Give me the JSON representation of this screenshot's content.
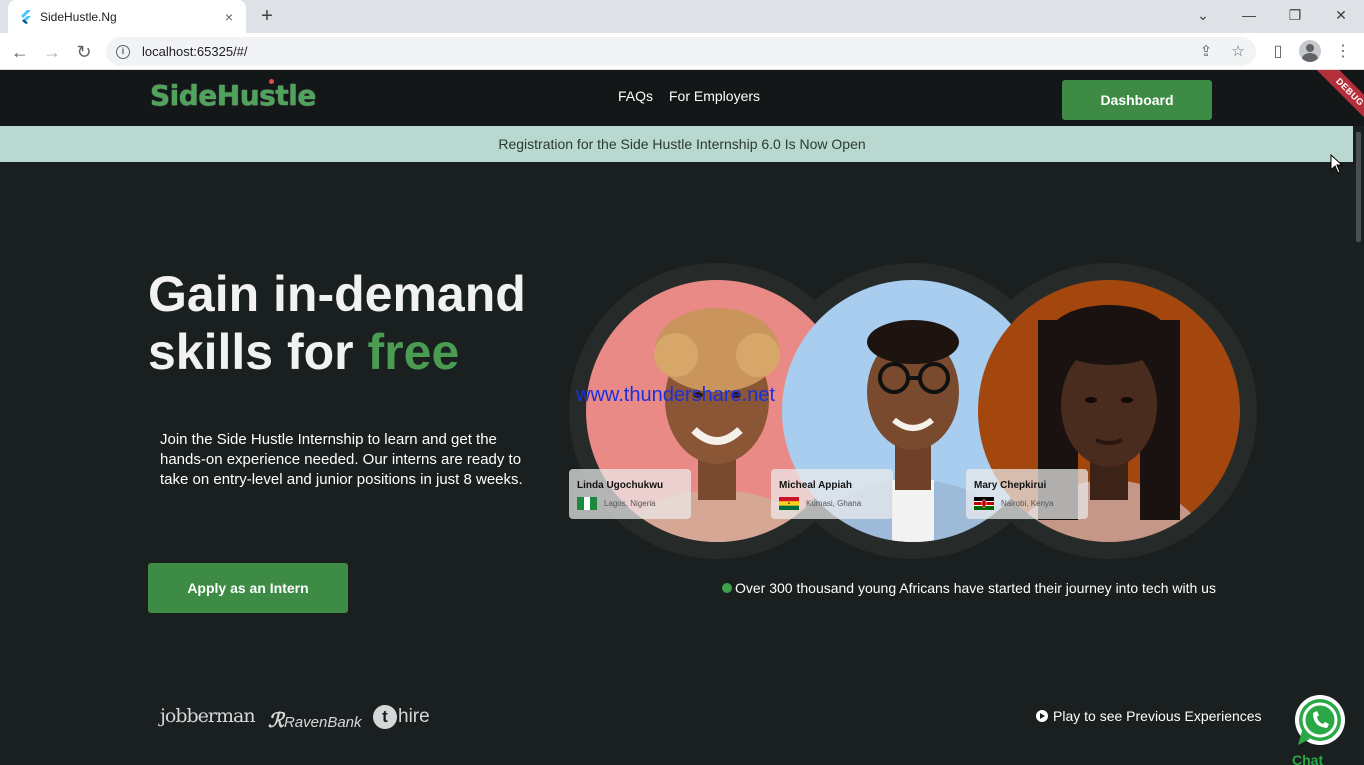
{
  "browser": {
    "tab_title": "SideHustle.Ng",
    "url": "localhost:65325/#/",
    "new_tab": "+",
    "close": "×"
  },
  "header": {
    "logo": "SideHustle",
    "nav": [
      "FAQs",
      "For Employers"
    ],
    "dashboard_label": "Dashboard",
    "debug_label": "DEBUG"
  },
  "announcement": "Registration for the Side Hustle Internship 6.0 Is Now Open",
  "hero": {
    "title_line1": "Gain in-demand",
    "title_line2_prefix": "skills for ",
    "title_line2_accent": "free",
    "description": "Join the Side Hustle Internship to learn and get the hands-on experience needed. Our interns are ready to take on entry-level and junior positions in just 8 weeks.",
    "apply_label": "Apply as an Intern"
  },
  "people": [
    {
      "name": "Linda Ugochukwu",
      "location": "Lagos, Nigeria",
      "flag": "nigeria"
    },
    {
      "name": "Micheal Appiah",
      "location": "Kumasi, Ghana",
      "flag": "ghana"
    },
    {
      "name": "Mary Chepkirui",
      "location": "Nairobi, Kenya",
      "flag": "kenya"
    }
  ],
  "watermark": "www.thundershare.net",
  "stat_text": "Over 300 thousand young Africans have started their journey into tech with us",
  "partners": [
    "jobberman",
    "RavenBank",
    "hire"
  ],
  "play_label": "Play to see Previous Experiences",
  "chat_label": "Chat",
  "colors": {
    "accent_green": "#3d8b45",
    "banner": "#b9d8cf",
    "background": "#1a1f1f"
  }
}
